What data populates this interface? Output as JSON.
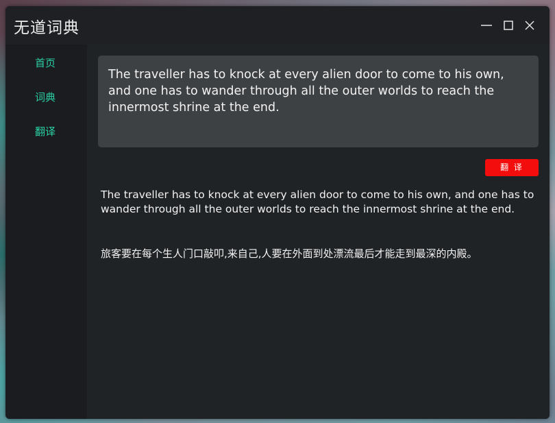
{
  "window": {
    "title": "无道词典"
  },
  "titlebar": {
    "icons": [
      "minimize-icon",
      "maximize-icon",
      "close-icon"
    ]
  },
  "sidebar": {
    "items": [
      {
        "label": "首页"
      },
      {
        "label": "词典"
      },
      {
        "label": "翻译"
      }
    ]
  },
  "main": {
    "input_text": "The traveller has to knock at every alien door to come to his own, and one has to wander through all the outer worlds to reach the innermost shrine at the end.",
    "translate_label": "翻 译",
    "result_original": "The traveller has to knock at every alien door to come to his own, and one has to wander through all the outer worlds to reach the innermost shrine at the end.",
    "result_translation": "旅客要在每个生人门口敲叩,来自己,人要在外面到处漂流最后才能走到最深的内殿。"
  },
  "colors": {
    "accent": "#2ad1a6",
    "translate_button": "#f30d0d",
    "window_bg": "#202326",
    "sidebar_bg": "#1a1c1f",
    "input_bg": "#3e4143"
  }
}
